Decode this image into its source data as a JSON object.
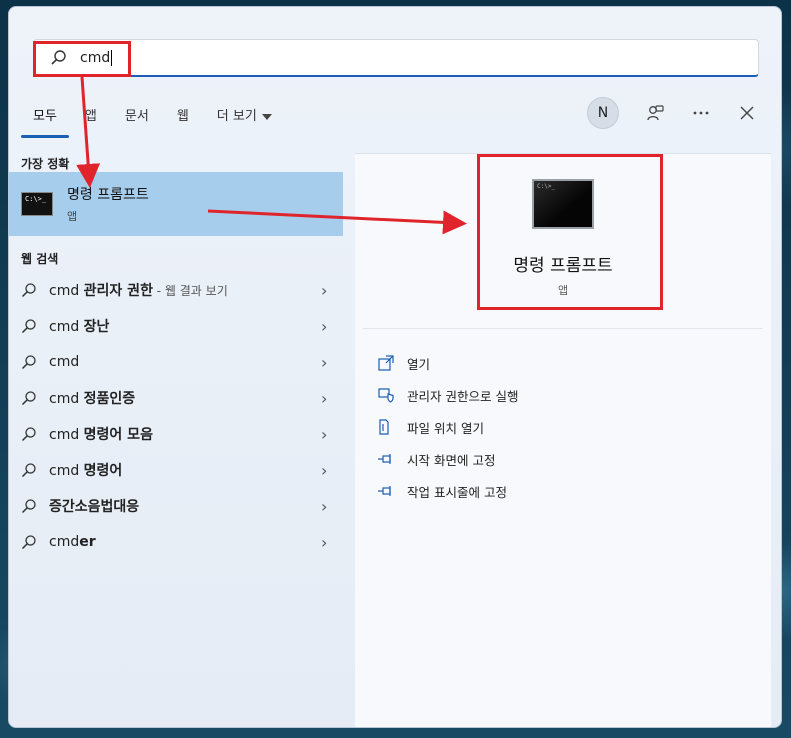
{
  "search": {
    "value": "cmd"
  },
  "tabs": [
    {
      "label": "모두"
    },
    {
      "label": "앱"
    },
    {
      "label": "문서"
    },
    {
      "label": "웹"
    },
    {
      "label": "더 보기"
    }
  ],
  "toolbar": {
    "avatar_initial": "N"
  },
  "best_match": {
    "section_title": "가장 정확",
    "name": "명령 프롬프트",
    "type": "앱",
    "icon_text": "C:\\>_"
  },
  "web_search": {
    "section_title": "웹 검색",
    "items": [
      {
        "prefix": "cmd ",
        "bold": "관리자 권한",
        "hint": " - 웹 결과 보기"
      },
      {
        "prefix": "cmd ",
        "bold": "장난",
        "hint": ""
      },
      {
        "prefix": "cmd",
        "bold": "",
        "hint": ""
      },
      {
        "prefix": "cmd ",
        "bold": "정품인증",
        "hint": ""
      },
      {
        "prefix": "cmd ",
        "bold": "명령어 모음",
        "hint": ""
      },
      {
        "prefix": "cmd ",
        "bold": "명령어",
        "hint": ""
      },
      {
        "prefix": "",
        "bold": "증간소음법대응",
        "hint": ""
      },
      {
        "prefix": "cmd",
        "bold": "er",
        "hint": ""
      }
    ]
  },
  "detail": {
    "name": "명령 프롬프트",
    "type": "앱",
    "actions": [
      {
        "label": "열기",
        "icon": "open-icon"
      },
      {
        "label": "관리자 권한으로 실행",
        "icon": "shield-icon"
      },
      {
        "label": "파일 위치 열기",
        "icon": "folder-icon"
      },
      {
        "label": "시작 화면에 고정",
        "icon": "pin-icon"
      },
      {
        "label": "작업 표시줄에 고정",
        "icon": "pin-icon"
      }
    ]
  },
  "colors": {
    "accent": "#1a5fb4",
    "selection": "#a6cdec",
    "annotation": "#e0242b"
  }
}
